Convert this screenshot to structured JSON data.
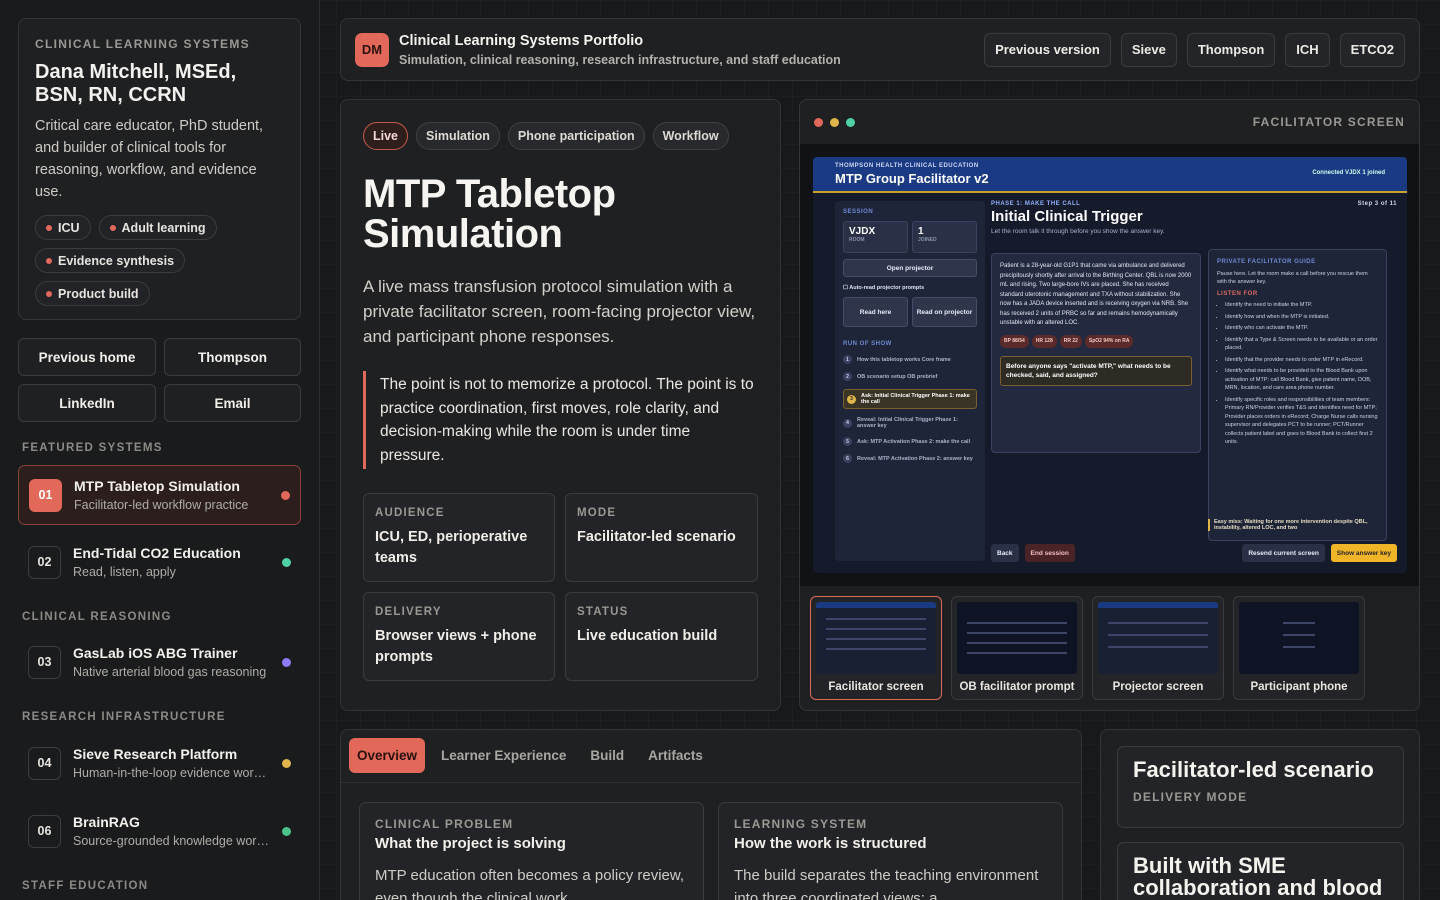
{
  "profile": {
    "eyebrow": "CLINICAL LEARNING SYSTEMS",
    "name": "Dana Mitchell, MSEd, BSN, RN, CCRN",
    "bio": "Critical care educator, PhD student, and builder of clinical tools for reasoning, workflow, and evidence use.",
    "chips": [
      "ICU",
      "Adult learning",
      "Evidence synthesis",
      "Product build"
    ]
  },
  "side_buttons": [
    "Previous home",
    "Thompson",
    "LinkedIn",
    "Email"
  ],
  "sections": {
    "featured": "FEATURED SYSTEMS",
    "reasoning": "CLINICAL REASONING",
    "research": "RESEARCH INFRASTRUCTURE",
    "staff": "STAFF EDUCATION"
  },
  "projects": [
    {
      "num": "01",
      "title": "MTP Tabletop Simulation",
      "sub": "Facilitator-led workflow practice",
      "color": "#e2685a"
    },
    {
      "num": "02",
      "title": "End-Tidal CO2 Education",
      "sub": "Read, listen, apply",
      "color": "#4fd1a5"
    },
    {
      "num": "03",
      "title": "GasLab iOS ABG Trainer",
      "sub": "Native arterial blood gas reasoning",
      "color": "#8b7cf6"
    },
    {
      "num": "04",
      "title": "Sieve Research Platform",
      "sub": "Human-in-the-loop evidence wor…",
      "color": "#e0b54a"
    },
    {
      "num": "06",
      "title": "BrainRAG",
      "sub": "Source-grounded knowledge wor…",
      "color": "#4cc38a"
    }
  ],
  "topbar": {
    "logo": "DM",
    "title": "Clinical Learning Systems Portfolio",
    "subtitle": "Simulation, clinical reasoning, research infrastructure, and staff education",
    "links": [
      "Previous version",
      "Sieve",
      "Thompson",
      "ICH",
      "ETCO2"
    ]
  },
  "hero": {
    "tags": [
      "Live",
      "Simulation",
      "Phone participation",
      "Workflow"
    ],
    "title": "MTP Tabletop Simulation",
    "lead": "A live mass transfusion protocol simulation with a private facilitator screen, room-facing projector view, and participant phone responses.",
    "quote": "The point is not to memorize a protocol. The point is to practice coordination, first moves, role clarity, and decision-making while the room is under time pressure.",
    "meta": [
      {
        "label": "AUDIENCE",
        "value": "ICU, ED, perioperative teams"
      },
      {
        "label": "MODE",
        "value": "Facilitator-led scenario"
      },
      {
        "label": "DELIVERY",
        "value": "Browser views + phone prompts"
      },
      {
        "label": "STATUS",
        "value": "Live education build"
      }
    ]
  },
  "viewer": {
    "label": "FACILITATOR SCREEN",
    "screen": {
      "org": "THOMPSON HEALTH CLINICAL EDUCATION",
      "title": "MTP Group Facilitator v2",
      "conn": "Connected   VJDX   1 joined",
      "session": "SESSION",
      "room_code": "VJDX",
      "room_label": "ROOM",
      "joined": "1",
      "joined_label": "JOINED",
      "open_projector": "Open projector",
      "auto_read": "Auto-read projector prompts",
      "read_here": "Read here",
      "read_projector": "Read on projector",
      "run_of_show": "RUN OF SHOW",
      "run": [
        {
          "n": "1",
          "t": "How this tabletop works  Core frame"
        },
        {
          "n": "2",
          "t": "OB scenario setup  OB prebrief"
        },
        {
          "n": "3",
          "t": "Ask: Initial Clinical Trigger  Phase 1: make the call"
        },
        {
          "n": "4",
          "t": "Reveal: Initial Clinical Trigger  Phase 1: answer key"
        },
        {
          "n": "5",
          "t": "Ask: MTP Activation  Phase 2: make the call"
        },
        {
          "n": "6",
          "t": "Reveal: MTP Activation  Phase 2: answer key"
        }
      ],
      "phase": "PHASE 1: MAKE THE CALL",
      "step": "Step 3 of 11",
      "heading": "Initial Clinical Trigger",
      "instruction": "Let the room talk it through before you show the answer key.",
      "scenario": "Patient is a 28-year-old G1P1 that came via ambulance and delivered precipitously shortly after arrival to the Birthing Center. QBL is now 2000 mL and rising. Two large-bore IVs are placed. She has received standard uterotonic management and TXA without stabilization. She now has a JADA device inserted and is receiving oxygen via NRB. She has received 2 units of PRBC so far and remains hemodynamically unstable with an altered LOC.",
      "vitals": [
        "BP 88/54",
        "HR 128",
        "RR 22",
        "SpO2 94% on RA"
      ],
      "ask": "Before anyone says \"activate MTP,\" what needs to be checked, said, and assigned?",
      "guide_title": "PRIVATE FACILITATOR GUIDE",
      "guide_intro": "Pause here. Let the room make a call before you rescue them with the answer key.",
      "listen": "LISTEN FOR",
      "guide_items": [
        "Identify the need to initiate the MTP.",
        "Identify how and when the MTP is initiated.",
        "Identify who can activate the MTP.",
        "Identify that a Type & Screen needs to be available or an order placed.",
        "Identify that the provider needs to order MTP in eRecord.",
        "Identify what needs to be provided to the Blood Bank upon activation of MTP: call Blood Bank, give patient name, DOB, MRN, location, and care area phone number.",
        "Identify specific roles and responsibilities of team members: Primary RN/Provider verifies T&S and identifies need for MTP; Provider places orders in eRecord; Charge Nurse calls nursing supervisor and delegates PCT to be runner; PCT/Runner collects patient label and goes to Blood Bank to collect first 2 units."
      ],
      "easy_miss": "Easy miss: Waiting for one more intervention despite QBL, instability, altered LOC, and two",
      "footer": {
        "back": "Back",
        "end": "End session",
        "resend": "Resend current screen",
        "show": "Show answer key"
      }
    },
    "thumbs": [
      "Facilitator screen",
      "OB facilitator prompt",
      "Projector screen",
      "Participant phone"
    ]
  },
  "tabs": [
    "Overview",
    "Learner Experience",
    "Build",
    "Artifacts"
  ],
  "overview": [
    {
      "label": "CLINICAL PROBLEM",
      "title": "What the project is solving",
      "text": "MTP education often becomes a policy review, even though the clinical work"
    },
    {
      "label": "LEARNING SYSTEM",
      "title": "How the work is structured",
      "text": "The build separates the teaching environment into three coordinated views: a"
    }
  ],
  "right_cards": [
    {
      "title": "Facilitator-led scenario",
      "sub": "DELIVERY MODE"
    },
    {
      "title": "Built with SME collaboration and blood",
      "sub": ""
    }
  ]
}
